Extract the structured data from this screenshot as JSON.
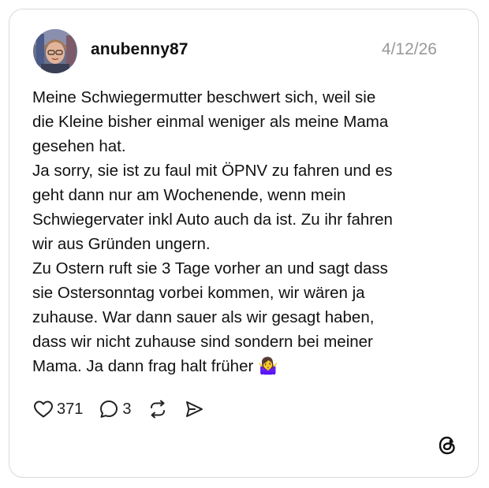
{
  "post": {
    "username": "anubenny87",
    "date": "4/12/26",
    "text": "Meine Schwiegermutter beschwert sich, weil sie\ndie Kleine bisher einmal weniger als meine Mama\ngesehen hat.\nJa sorry, sie ist zu faul mit ÖPNV zu fahren und es\ngeht dann nur am Wochenende, wenn mein\nSchwiegervater inkl Auto auch da ist. Zu ihr fahren\nwir aus Gründen ungern.\nZu Ostern ruft sie 3 Tage vorher an und sagt dass\nsie Ostersonntag vorbei kommen, wir wären ja\nzuhause. War dann sauer als wir gesagt haben,\ndass wir nicht zuhause sind sondern bei meiner\nMama. Ja dann frag halt früher 🤷‍♀️",
    "likes": "371",
    "replies": "3"
  },
  "icons": {
    "like": "heart-icon",
    "reply": "speech-bubble-icon",
    "repost": "repost-icon",
    "share": "send-icon",
    "logo": "threads-logo-icon"
  },
  "colors": {
    "text": "#111111",
    "muted": "#999999",
    "border": "#d9d9d9"
  }
}
